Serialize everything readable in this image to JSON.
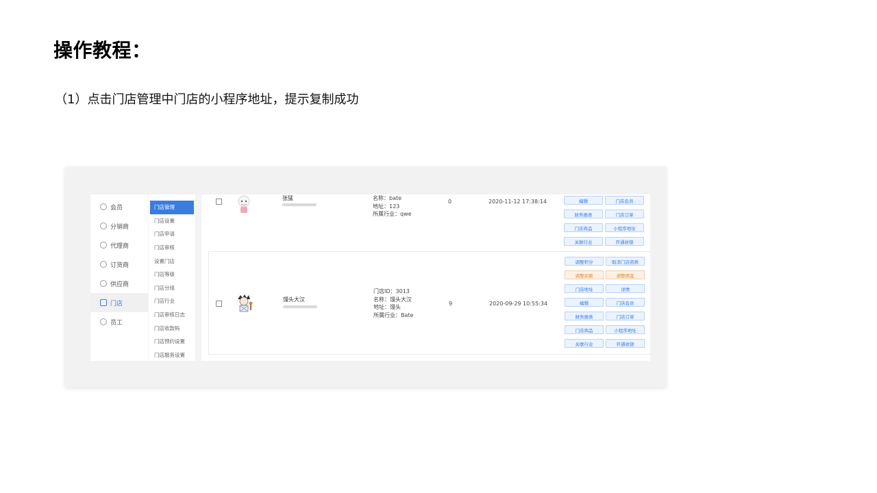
{
  "doc": {
    "title": "操作教程：",
    "step": "（1）点击门店管理中门店的小程序地址，提示复制成功"
  },
  "sidebar_main": [
    {
      "label": "会员",
      "icon": "user-icon"
    },
    {
      "label": "分销商",
      "icon": "distributor-icon"
    },
    {
      "label": "代理商",
      "icon": "agent-icon"
    },
    {
      "label": "订货商",
      "icon": "order-icon"
    },
    {
      "label": "供应商",
      "icon": "supplier-icon"
    },
    {
      "label": "门店",
      "icon": "store-icon",
      "active": true
    },
    {
      "label": "员工",
      "icon": "staff-icon"
    }
  ],
  "sidebar_sub": [
    {
      "label": "门店管理",
      "active": true
    },
    {
      "label": "门店设置"
    },
    {
      "label": "门店申请"
    },
    {
      "label": "门店审核"
    },
    {
      "label": "设置门店"
    },
    {
      "label": "门店等级"
    },
    {
      "label": "门店分组"
    },
    {
      "label": "门店行业"
    },
    {
      "label": "门店审核日志"
    },
    {
      "label": "门店收款码"
    },
    {
      "label": "门店预约设置"
    },
    {
      "label": "门店服务设置"
    }
  ],
  "rows": [
    {
      "name": "张猛",
      "info": [
        "名称：bate",
        "地址：123",
        "所属行业：qwe"
      ],
      "count": "0",
      "time": "2020-11-12 17:38:14",
      "ops": [
        {
          "label": "编辑"
        },
        {
          "label": "门店会员"
        },
        {
          "label": "财务报表"
        },
        {
          "label": "门店订单"
        },
        {
          "label": "门店商品"
        },
        {
          "label": "小程序地址"
        },
        {
          "label": "关联行业"
        },
        {
          "label": "开通收银"
        }
      ]
    },
    {
      "name": "馒头大汉",
      "info": [
        "门店ID：3013",
        "名称：馒头大汉",
        "地址：馒头",
        "所属行业：Bate"
      ],
      "count": "9",
      "time": "2020-09-29 10:55:34",
      "ops": [
        {
          "label": "调整积分"
        },
        {
          "label": "取消门店资质"
        },
        {
          "label": "调整余额",
          "warn": true
        },
        {
          "label": "调整佣金",
          "warn": true
        },
        {
          "label": "门店地址"
        },
        {
          "label": "详情"
        },
        {
          "label": "编辑"
        },
        {
          "label": "门店会员"
        },
        {
          "label": "财务报表"
        },
        {
          "label": "门店订单"
        },
        {
          "label": "门店商品"
        },
        {
          "label": "小程序地址"
        },
        {
          "label": "关联行业"
        },
        {
          "label": "开通收银"
        }
      ]
    }
  ],
  "colors": {
    "accent": "#3a7de0",
    "warn": "#e08a35"
  }
}
